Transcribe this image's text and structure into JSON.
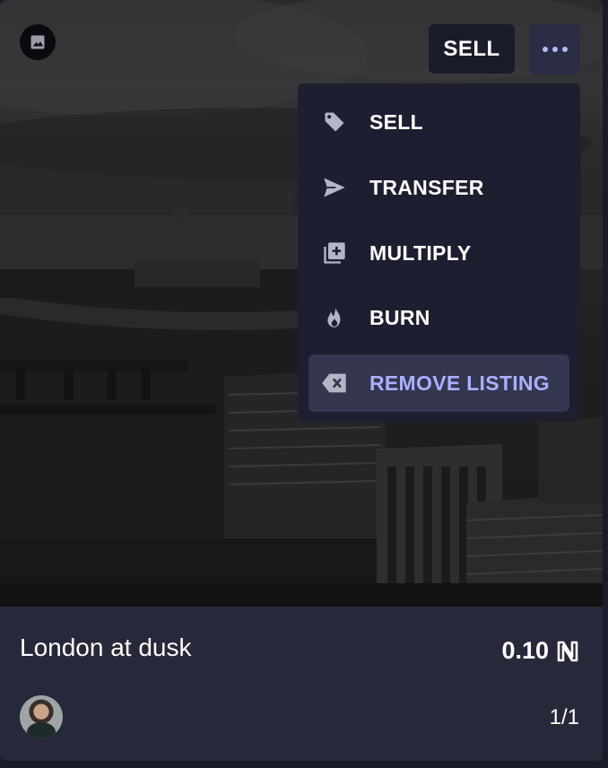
{
  "card": {
    "title": "London at dusk",
    "price": "0.10",
    "currency_icon": "near-token-icon",
    "edition": "1/1",
    "image_badge_icon": "image-icon",
    "avatar_icon": "user-avatar"
  },
  "toolbar": {
    "sell_label": "SELL",
    "more_icon": "more-dots-icon"
  },
  "menu": {
    "items": [
      {
        "label": "SELL",
        "icon": "tag-icon"
      },
      {
        "label": "TRANSFER",
        "icon": "send-icon"
      },
      {
        "label": "MULTIPLY",
        "icon": "library-add-icon"
      },
      {
        "label": "BURN",
        "icon": "fire-icon"
      },
      {
        "label": "REMOVE LISTING",
        "icon": "backspace-icon",
        "active": true
      }
    ]
  },
  "colors": {
    "card_bg": "#272839",
    "menu_bg": "#1d1e30",
    "accent": "#a9b0ff",
    "active_item_bg": "#35364f"
  }
}
